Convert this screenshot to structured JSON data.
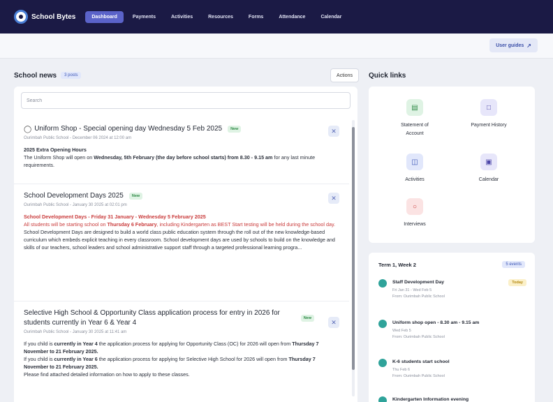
{
  "header": {
    "brand": "School Bytes",
    "nav": [
      "Dashboard",
      "Payments",
      "Activities",
      "Resources",
      "Forms",
      "Attendance",
      "Calendar"
    ],
    "active_nav": "Dashboard",
    "user_guides": "User guides"
  },
  "news": {
    "title": "School news",
    "count": "3 posts",
    "actions": "Actions",
    "search_placeholder": "Search",
    "posts": [
      {
        "title": "Uniform Shop - Special opening day Wednesday 5 Feb 2025",
        "badge": "New",
        "meta": "Ourimbah Public School - December 06 2024 at 12:00 am",
        "heading": "2025 Extra Opening Hours",
        "body_pre": "The Uniform Shop will open on ",
        "body_bold": "Wednesday, 5th February (the day before school starts) from 8.30 - 9.15 am",
        "body_post": " for any last minute requirements."
      },
      {
        "title": "School Development Days 2025",
        "badge": "New",
        "meta": "Ourimbah Public School - January 30 2025 at 02:01 pm",
        "red_heading": "School Development Days - Friday 31 January - Wednesday 5 February 2025",
        "red_pre": "All students will be starting school on ",
        "red_bold": "Thursday 6 February",
        "red_post": ", including Kindergarten as BEST Start testing will be held during the school day.",
        "body": "School Development Days are designed to build a world class public education system through the roll out of the new knowledge-based curriculum which embeds explicit teaching in every classroom. School development days are used by schools to build on the knowledge and skills of our teachers, school leaders and school administrative support staff through a targeted professional learning progra..."
      },
      {
        "title": "Selective High School & Opportunity Class application process for entry in 2026 for students currently in Year 6 & Year 4",
        "badge": "New",
        "meta": "Ourimbah Public School - January 30 2025 at 11:41 am",
        "l1_pre": "If you child is ",
        "l1_bold": "currently in Year 4",
        "l1_post": " the application process for applying for Opportunity Class (OC) for 2026 will open from ",
        "l1_bold2": "Thursday 7 November to 21 February 2025.",
        "l2_pre": "If you child is ",
        "l2_bold": "currently in Year 6",
        "l2_post": " the application process for applying for Selective High School for 2026 will open from ",
        "l2_bold2": "Thursday 7 November to 21 February 2025.",
        "l3": "Please find attached detailed information on how to apply to these classes."
      }
    ]
  },
  "quick_links": {
    "title": "Quick links",
    "items": [
      {
        "label": "Statement of Account",
        "icon": "document-icon"
      },
      {
        "label": "Payment History",
        "icon": "bookmark-icon"
      },
      {
        "label": "Activities",
        "icon": "book-icon"
      },
      {
        "label": "Calendar",
        "icon": "calendar-icon"
      },
      {
        "label": "Interviews",
        "icon": "chat-icon"
      }
    ]
  },
  "term": {
    "title": "Term 1, Week 2",
    "count": "5 events",
    "events": [
      {
        "title": "Staff Development Day",
        "dates": "Fri Jan 31 - Wed Feb 5",
        "place": "From: Ourimbah Public School",
        "badge": "Today"
      },
      {
        "title": "Uniform shop open - 8.30 am - 9.15 am",
        "dates": "Wed Feb 5",
        "place": "From: Ourimbah Public School"
      },
      {
        "title": "K-6 students start school",
        "dates": "Thu Feb 6",
        "place": "From: Ourimbah Public School"
      },
      {
        "title": "Kindergarten Information evening",
        "dates": "",
        "place": ""
      }
    ]
  },
  "colors": {
    "nav_bg": "#1b1a45",
    "accent": "#5b63c9",
    "event_dot": "#2fa39a",
    "alert_red": "#c93a3a"
  }
}
